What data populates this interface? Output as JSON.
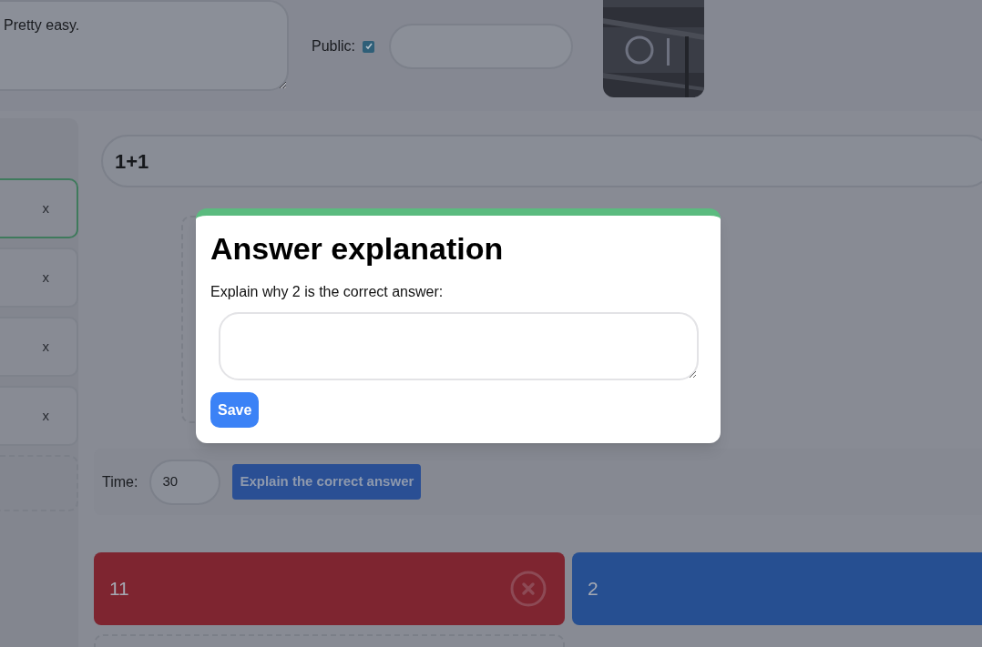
{
  "header": {
    "description": "Pretty easy.",
    "public": {
      "label": "Public:",
      "checked": true
    }
  },
  "sidebar": {
    "questions": [
      {
        "delete": "x",
        "selected": true
      },
      {
        "delete": "x",
        "selected": false
      },
      {
        "delete": "x",
        "selected": false
      },
      {
        "delete": "x",
        "selected": false
      }
    ]
  },
  "question": {
    "title": "1+1",
    "time_label": "Time:",
    "time_value": "30",
    "explain_button": "Explain the correct answer"
  },
  "answers": [
    {
      "text": "11",
      "color": "#7e2530",
      "kind": "removable"
    },
    {
      "text": "2",
      "color": "#264f91",
      "kind": "plain"
    }
  ],
  "modal": {
    "title": "Answer explanation",
    "prompt": "Explain why 2 is the correct answer:",
    "save_button": "Save"
  }
}
